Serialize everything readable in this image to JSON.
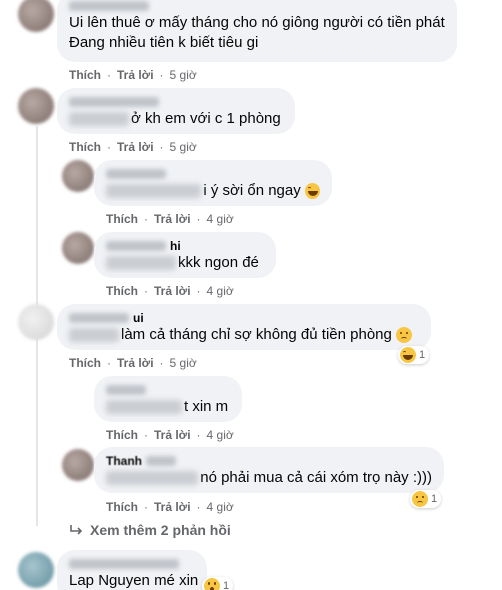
{
  "comments": [
    {
      "text": "Ui lên thuê ơ mấy tháng cho nó giông người có tiền phát",
      "text2": "Đang nhiều tiên k biết tiêu gi",
      "like": "Thích",
      "reply": "Trả lời",
      "time": "5 giờ"
    },
    {
      "text": "ở kh em với c 1 phòng",
      "like": "Thích",
      "reply": "Trả lời",
      "time": "5 giờ"
    },
    {
      "text": "i ý sời ổn ngay",
      "emoji": "rofl-emoji",
      "like": "Thích",
      "reply": "Trả lời",
      "time": "4 giờ"
    },
    {
      "name_suffix": "hi",
      "text": "kkk ngon đé",
      "like": "Thích",
      "reply": "Trả lời",
      "time": "4 giờ"
    },
    {
      "name_suffix": "ui",
      "text": "làm cả tháng chỉ sợ không đủ tiền phòng",
      "emoji": "sad-emoji",
      "reaction_count": "1",
      "like": "Thích",
      "reply": "Trả lời",
      "time": "5 giờ"
    },
    {
      "text": "t xin m",
      "like": "Thích",
      "reply": "Trả lời",
      "time": "4 giờ"
    },
    {
      "name_prefix": "Thanh",
      "text": "nó phải mua cả cái xóm trọ này :)))",
      "reaction_count": "1",
      "like": "Thích",
      "reply": "Trả lời",
      "time": "4 giờ"
    },
    {
      "text": "Lap Nguyen mé xin",
      "reaction_count": "1"
    }
  ],
  "see_more": "Xem thêm 2 phản hồi",
  "colors": {
    "bubble": "#f0f2f5",
    "meta": "#65676b",
    "text": "#050505"
  }
}
